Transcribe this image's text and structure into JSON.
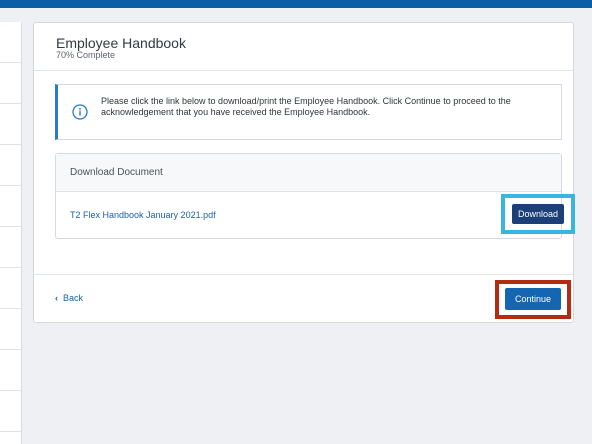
{
  "header": {
    "title": "Employee Handbook",
    "progress_text": "70% Complete"
  },
  "info": {
    "icon": "info-circle-icon",
    "message": "Please click the link below to download/print the Employee Handbook. Click Continue to proceed to the acknowledgement that you have received the Employee Handbook."
  },
  "document": {
    "heading": "Download Document",
    "file_name": "T2 Flex Handbook January 2021.pdf",
    "download_label": "Download"
  },
  "footer": {
    "back_icon": "chevron-left-icon",
    "back_label": "Back",
    "continue_label": "Continue"
  },
  "colors": {
    "top_bar": "#0a5ea8",
    "download_button": "#1b3f79",
    "continue_button": "#1566b0",
    "download_highlight": "#38b5e3",
    "continue_highlight": "#b22b13",
    "link": "#1f5fa6"
  }
}
